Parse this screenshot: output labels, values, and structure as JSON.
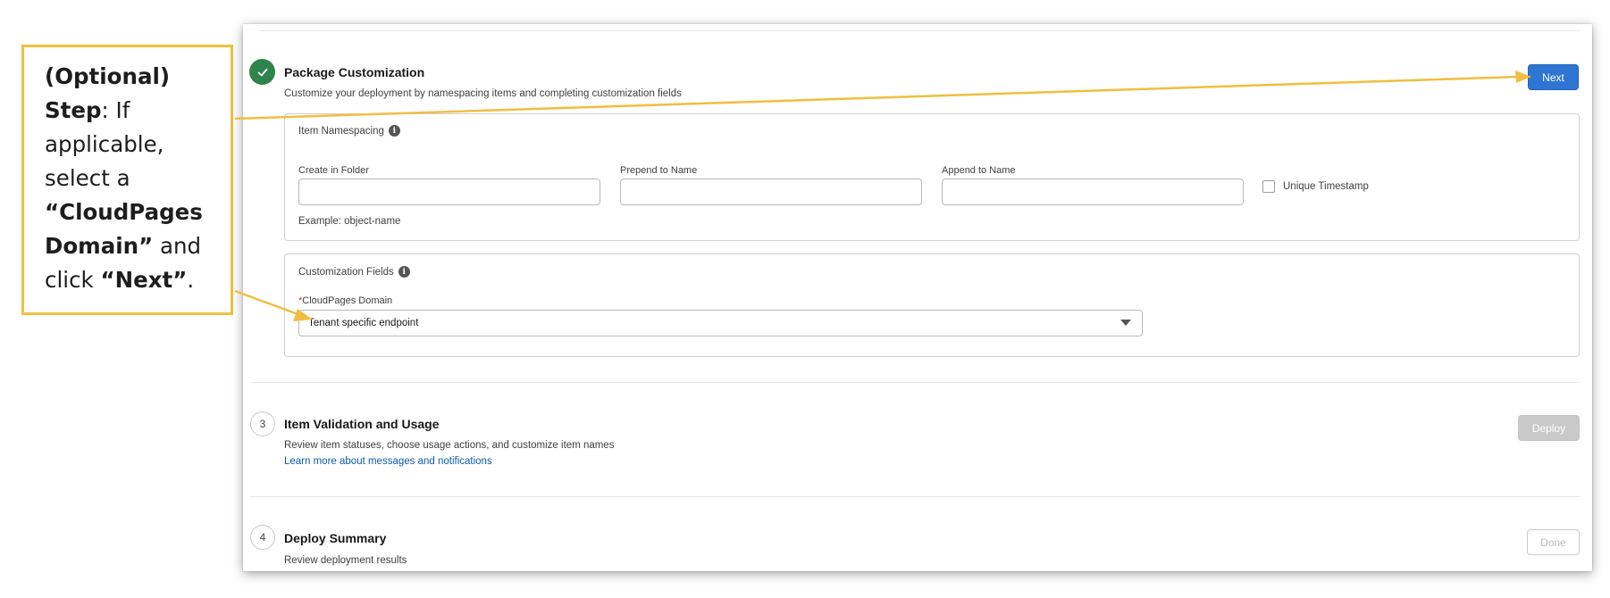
{
  "callout": {
    "line1": "(Optional)",
    "line2_bold": "Step",
    "line2_rest": ": If",
    "line3": "applicable,",
    "line4": "select a",
    "line5": "“CloudPages",
    "line6_bold": "Domain”",
    "line6_rest": " and",
    "line7_prefix": "click ",
    "line7_bold": "“Next”",
    "line7_suffix": "."
  },
  "step2": {
    "title": "Package Customization",
    "description": "Customize your deployment by namespacing items and completing customization fields",
    "next_label": "Next"
  },
  "namespacing": {
    "heading": "Item Namespacing",
    "create_in_folder_label": "Create in Folder",
    "create_in_folder_value": "",
    "prepend_label": "Prepend to Name",
    "prepend_value": "",
    "append_label": "Append to Name",
    "append_value": "",
    "unique_timestamp_label": "Unique Timestamp",
    "example": "Example: object-name"
  },
  "customization": {
    "heading": "Customization Fields",
    "required_mark": "*",
    "domain_label": "CloudPages Domain",
    "domain_value": "Tenant specific endpoint"
  },
  "step3": {
    "number": "3",
    "title": "Item Validation and Usage",
    "description": "Review item statuses, choose usage actions, and customize item names",
    "link": "Learn more about messages and notifications",
    "deploy_label": "Deploy"
  },
  "step4": {
    "number": "4",
    "title": "Deploy Summary",
    "description": "Review deployment results",
    "done_label": "Done"
  },
  "colors": {
    "callout_border": "#F0BE41",
    "arrow": "#F0BE41",
    "success": "#2e844a",
    "brand": "#2f76d2"
  }
}
